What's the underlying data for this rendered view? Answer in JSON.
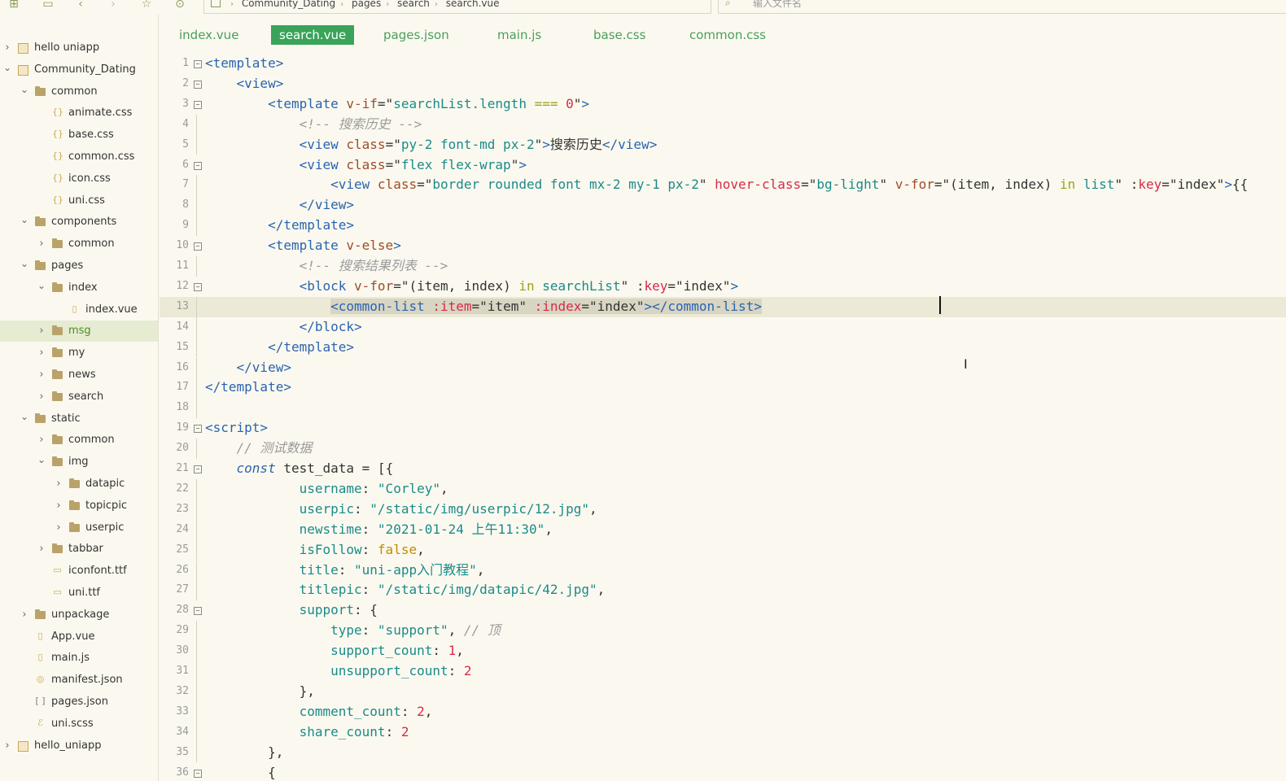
{
  "toolbar": {
    "icons": [
      "new-file-icon",
      "save-icon",
      "back-icon",
      "forward-icon",
      "favorite-icon",
      "run-icon"
    ],
    "breadcrumb": [
      "Community_Dating",
      "pages",
      "search",
      "search.vue"
    ],
    "file_search_placeholder": "输入文件名"
  },
  "sidebar": {
    "items": [
      {
        "label": "hello uniapp",
        "depth": 0,
        "kind": "project",
        "expanded": false
      },
      {
        "label": "Community_Dating",
        "depth": 0,
        "kind": "project",
        "expanded": true
      },
      {
        "label": "common",
        "depth": 1,
        "kind": "folder",
        "expanded": true
      },
      {
        "label": "animate.css",
        "depth": 2,
        "kind": "css"
      },
      {
        "label": "base.css",
        "depth": 2,
        "kind": "css"
      },
      {
        "label": "common.css",
        "depth": 2,
        "kind": "css"
      },
      {
        "label": "icon.css",
        "depth": 2,
        "kind": "css"
      },
      {
        "label": "uni.css",
        "depth": 2,
        "kind": "css"
      },
      {
        "label": "components",
        "depth": 1,
        "kind": "folder",
        "expanded": true
      },
      {
        "label": "common",
        "depth": 2,
        "kind": "folder",
        "expanded": false
      },
      {
        "label": "pages",
        "depth": 1,
        "kind": "folder",
        "expanded": true
      },
      {
        "label": "index",
        "depth": 2,
        "kind": "folder",
        "expanded": true
      },
      {
        "label": "index.vue",
        "depth": 3,
        "kind": "vue"
      },
      {
        "label": "msg",
        "depth": 2,
        "kind": "folder",
        "expanded": false,
        "selected": true
      },
      {
        "label": "my",
        "depth": 2,
        "kind": "folder",
        "expanded": false
      },
      {
        "label": "news",
        "depth": 2,
        "kind": "folder",
        "expanded": false
      },
      {
        "label": "search",
        "depth": 2,
        "kind": "folder",
        "expanded": false
      },
      {
        "label": "static",
        "depth": 1,
        "kind": "folder",
        "expanded": true
      },
      {
        "label": "common",
        "depth": 2,
        "kind": "folder",
        "expanded": false
      },
      {
        "label": "img",
        "depth": 2,
        "kind": "folder",
        "expanded": true
      },
      {
        "label": "datapic",
        "depth": 3,
        "kind": "folder",
        "expanded": false
      },
      {
        "label": "topicpic",
        "depth": 3,
        "kind": "folder",
        "expanded": false
      },
      {
        "label": "userpic",
        "depth": 3,
        "kind": "folder",
        "expanded": false
      },
      {
        "label": "tabbar",
        "depth": 2,
        "kind": "folder",
        "expanded": false
      },
      {
        "label": "iconfont.ttf",
        "depth": 2,
        "kind": "file"
      },
      {
        "label": "uni.ttf",
        "depth": 2,
        "kind": "file"
      },
      {
        "label": "unpackage",
        "depth": 1,
        "kind": "folder",
        "expanded": false
      },
      {
        "label": "App.vue",
        "depth": 1,
        "kind": "vue"
      },
      {
        "label": "main.js",
        "depth": 1,
        "kind": "js"
      },
      {
        "label": "manifest.json",
        "depth": 1,
        "kind": "manifest"
      },
      {
        "label": "pages.json",
        "depth": 1,
        "kind": "json"
      },
      {
        "label": "uni.scss",
        "depth": 1,
        "kind": "scss"
      },
      {
        "label": "hello_uniapp",
        "depth": 0,
        "kind": "project",
        "expanded": false
      }
    ]
  },
  "tabs": [
    {
      "label": "index.vue"
    },
    {
      "label": "search.vue",
      "active": true
    },
    {
      "label": "pages.json"
    },
    {
      "label": "main.js"
    },
    {
      "label": "base.css"
    },
    {
      "label": "common.css"
    }
  ],
  "editor": {
    "current_line": 13,
    "lines": [
      {
        "n": "1",
        "fold": true,
        "parts": [
          [
            "t",
            "<template>"
          ]
        ]
      },
      {
        "n": "2",
        "fold": true,
        "parts": [
          [
            "",
            "    "
          ],
          [
            "t",
            "<view>"
          ]
        ]
      },
      {
        "n": "3",
        "fold": true,
        "parts": [
          [
            "",
            "        "
          ],
          [
            "t",
            "<template "
          ],
          [
            "a",
            "v-if"
          ],
          [
            "",
            "=\""
          ],
          [
            "s",
            "searchList.length "
          ],
          [
            "o",
            "==="
          ],
          [
            "s",
            " "
          ],
          [
            "n",
            "0"
          ],
          [
            "",
            "\""
          ],
          [
            "t",
            ">"
          ]
        ]
      },
      {
        "n": "4",
        "parts": [
          [
            "",
            "            "
          ],
          [
            "c",
            "<!-- 搜索历史 -->"
          ]
        ]
      },
      {
        "n": "5",
        "parts": [
          [
            "",
            "            "
          ],
          [
            "t",
            "<view "
          ],
          [
            "a",
            "class"
          ],
          [
            "",
            "=\""
          ],
          [
            "s",
            "py-2 font-md px-2"
          ],
          [
            "",
            "\""
          ],
          [
            "t",
            ">"
          ],
          [
            "",
            "搜索历史"
          ],
          [
            "t",
            "</view>"
          ]
        ]
      },
      {
        "n": "6",
        "fold": true,
        "parts": [
          [
            "",
            "            "
          ],
          [
            "t",
            "<view "
          ],
          [
            "a",
            "class"
          ],
          [
            "",
            "=\""
          ],
          [
            "s",
            "flex flex-wrap"
          ],
          [
            "",
            "\""
          ],
          [
            "t",
            ">"
          ]
        ]
      },
      {
        "n": "7",
        "parts": [
          [
            "",
            "                "
          ],
          [
            "t",
            "<view "
          ],
          [
            "a",
            "class"
          ],
          [
            "",
            "=\""
          ],
          [
            "s",
            "border rounded font mx-2 my-1 px-2"
          ],
          [
            "",
            "\" "
          ],
          [
            "n",
            "hover-class"
          ],
          [
            "",
            "=\""
          ],
          [
            "s",
            "bg-light"
          ],
          [
            "",
            "\" "
          ],
          [
            "a",
            "v-for"
          ],
          [
            "",
            "=\"(item, index) "
          ],
          [
            "o",
            "in"
          ],
          [
            "s",
            " list"
          ],
          [
            "",
            "\" :"
          ],
          [
            "n",
            "key"
          ],
          [
            "",
            "=\"index\""
          ],
          [
            "t",
            ">"
          ],
          [
            "",
            "{{"
          ]
        ]
      },
      {
        "n": "8",
        "parts": [
          [
            "",
            "            "
          ],
          [
            "t",
            "</view>"
          ]
        ]
      },
      {
        "n": "9",
        "parts": [
          [
            "",
            "        "
          ],
          [
            "t",
            "</template>"
          ]
        ]
      },
      {
        "n": "10",
        "fold": true,
        "parts": [
          [
            "",
            "        "
          ],
          [
            "t",
            "<template "
          ],
          [
            "a",
            "v-else"
          ],
          [
            "t",
            ">"
          ]
        ]
      },
      {
        "n": "11",
        "parts": [
          [
            "",
            "            "
          ],
          [
            "c",
            "<!-- 搜索结果列表 -->"
          ]
        ]
      },
      {
        "n": "12",
        "fold": true,
        "parts": [
          [
            "",
            "            "
          ],
          [
            "t",
            "<block "
          ],
          [
            "a",
            "v-for"
          ],
          [
            "",
            "=\"(item, index) "
          ],
          [
            "o",
            "in"
          ],
          [
            "s",
            " searchList"
          ],
          [
            "",
            "\" :"
          ],
          [
            "n",
            "key"
          ],
          [
            "",
            "=\"index\""
          ],
          [
            "t",
            ">"
          ]
        ]
      },
      {
        "n": "13",
        "parts": [
          [
            "",
            "                "
          ],
          [
            "t",
            "<common-list "
          ],
          [
            "n",
            ":item"
          ],
          [
            "",
            "=\"item\" "
          ],
          [
            "n",
            ":index"
          ],
          [
            "",
            "=\"index\""
          ],
          [
            "t",
            "></common-list>"
          ]
        ]
      },
      {
        "n": "14",
        "parts": [
          [
            "",
            "            "
          ],
          [
            "t",
            "</block>"
          ]
        ]
      },
      {
        "n": "15",
        "parts": [
          [
            "",
            "        "
          ],
          [
            "t",
            "</template>"
          ]
        ]
      },
      {
        "n": "16",
        "parts": [
          [
            "",
            "    "
          ],
          [
            "t",
            "</view>"
          ]
        ]
      },
      {
        "n": "17",
        "parts": [
          [
            "t",
            "</template>"
          ]
        ]
      },
      {
        "n": "18",
        "parts": []
      },
      {
        "n": "19",
        "fold": true,
        "parts": [
          [
            "t",
            "<script>"
          ]
        ]
      },
      {
        "n": "20",
        "parts": [
          [
            "",
            "    "
          ],
          [
            "c",
            "// 测试数据"
          ]
        ]
      },
      {
        "n": "21",
        "fold": true,
        "parts": [
          [
            "",
            "    "
          ],
          [
            "k",
            "const"
          ],
          [
            "",
            " test_data = [{"
          ]
        ]
      },
      {
        "n": "22",
        "parts": [
          [
            "",
            "            "
          ],
          [
            "p",
            "username"
          ],
          [
            "",
            ": "
          ],
          [
            "s",
            "\"Corley\""
          ],
          [
            "",
            ","
          ]
        ]
      },
      {
        "n": "23",
        "parts": [
          [
            "",
            "            "
          ],
          [
            "p",
            "userpic"
          ],
          [
            "",
            ": "
          ],
          [
            "s",
            "\"/static/img/userpic/12.jpg\""
          ],
          [
            "",
            ","
          ]
        ]
      },
      {
        "n": "24",
        "parts": [
          [
            "",
            "            "
          ],
          [
            "p",
            "newstime"
          ],
          [
            "",
            ": "
          ],
          [
            "s",
            "\"2021-01-24 上午11:30\""
          ],
          [
            "",
            ","
          ]
        ]
      },
      {
        "n": "25",
        "parts": [
          [
            "",
            "            "
          ],
          [
            "p",
            "isFollow"
          ],
          [
            "",
            ": "
          ],
          [
            "b",
            "false"
          ],
          [
            "",
            ","
          ]
        ]
      },
      {
        "n": "26",
        "parts": [
          [
            "",
            "            "
          ],
          [
            "p",
            "title"
          ],
          [
            "",
            ": "
          ],
          [
            "s",
            "\"uni-app入门教程\""
          ],
          [
            "",
            ","
          ]
        ]
      },
      {
        "n": "27",
        "parts": [
          [
            "",
            "            "
          ],
          [
            "p",
            "titlepic"
          ],
          [
            "",
            ": "
          ],
          [
            "s",
            "\"/static/img/datapic/42.jpg\""
          ],
          [
            "",
            ","
          ]
        ]
      },
      {
        "n": "28",
        "fold": true,
        "parts": [
          [
            "",
            "            "
          ],
          [
            "p",
            "support"
          ],
          [
            "",
            ": {"
          ]
        ]
      },
      {
        "n": "29",
        "parts": [
          [
            "",
            "                "
          ],
          [
            "p",
            "type"
          ],
          [
            "",
            ": "
          ],
          [
            "s",
            "\"support\""
          ],
          [
            "",
            ", "
          ],
          [
            "c",
            "// 顶"
          ]
        ]
      },
      {
        "n": "30",
        "parts": [
          [
            "",
            "                "
          ],
          [
            "p",
            "support_count"
          ],
          [
            "",
            ": "
          ],
          [
            "n",
            "1"
          ],
          [
            "",
            ","
          ]
        ]
      },
      {
        "n": "31",
        "parts": [
          [
            "",
            "                "
          ],
          [
            "p",
            "unsupport_count"
          ],
          [
            "",
            ": "
          ],
          [
            "n",
            "2"
          ]
        ]
      },
      {
        "n": "32",
        "parts": [
          [
            "",
            "            },"
          ]
        ]
      },
      {
        "n": "33",
        "parts": [
          [
            "",
            "            "
          ],
          [
            "p",
            "comment_count"
          ],
          [
            "",
            ": "
          ],
          [
            "n",
            "2"
          ],
          [
            "",
            ","
          ]
        ]
      },
      {
        "n": "34",
        "parts": [
          [
            "",
            "            "
          ],
          [
            "p",
            "share_count"
          ],
          [
            "",
            ": "
          ],
          [
            "n",
            "2"
          ]
        ]
      },
      {
        "n": "35",
        "parts": [
          [
            "",
            "        },"
          ]
        ]
      },
      {
        "n": "36",
        "fold": true,
        "parts": [
          [
            "",
            "        {"
          ]
        ]
      }
    ]
  }
}
